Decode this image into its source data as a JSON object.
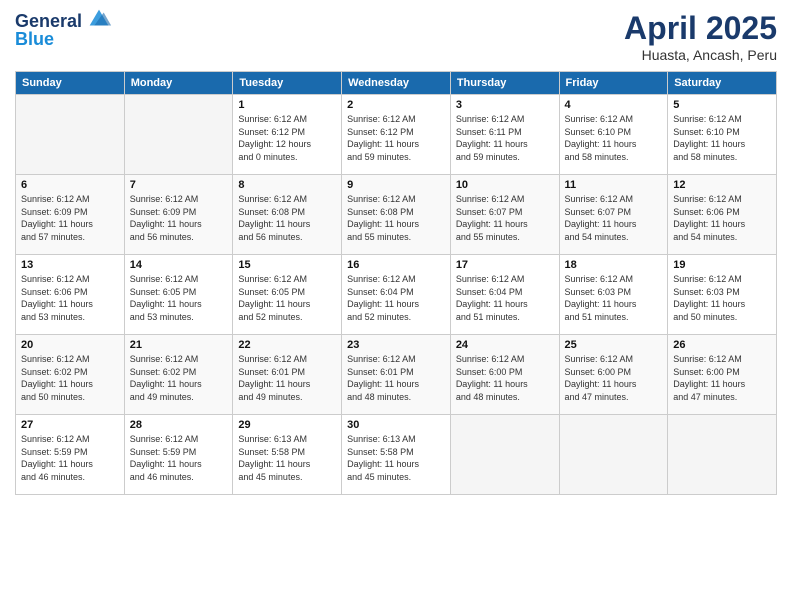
{
  "logo": {
    "line1": "General",
    "line2": "Blue"
  },
  "title": "April 2025",
  "subtitle": "Huasta, Ancash, Peru",
  "weekdays": [
    "Sunday",
    "Monday",
    "Tuesday",
    "Wednesday",
    "Thursday",
    "Friday",
    "Saturday"
  ],
  "weeks": [
    [
      {
        "day": "",
        "info": ""
      },
      {
        "day": "",
        "info": ""
      },
      {
        "day": "1",
        "info": "Sunrise: 6:12 AM\nSunset: 6:12 PM\nDaylight: 12 hours\nand 0 minutes."
      },
      {
        "day": "2",
        "info": "Sunrise: 6:12 AM\nSunset: 6:12 PM\nDaylight: 11 hours\nand 59 minutes."
      },
      {
        "day": "3",
        "info": "Sunrise: 6:12 AM\nSunset: 6:11 PM\nDaylight: 11 hours\nand 59 minutes."
      },
      {
        "day": "4",
        "info": "Sunrise: 6:12 AM\nSunset: 6:10 PM\nDaylight: 11 hours\nand 58 minutes."
      },
      {
        "day": "5",
        "info": "Sunrise: 6:12 AM\nSunset: 6:10 PM\nDaylight: 11 hours\nand 58 minutes."
      }
    ],
    [
      {
        "day": "6",
        "info": "Sunrise: 6:12 AM\nSunset: 6:09 PM\nDaylight: 11 hours\nand 57 minutes."
      },
      {
        "day": "7",
        "info": "Sunrise: 6:12 AM\nSunset: 6:09 PM\nDaylight: 11 hours\nand 56 minutes."
      },
      {
        "day": "8",
        "info": "Sunrise: 6:12 AM\nSunset: 6:08 PM\nDaylight: 11 hours\nand 56 minutes."
      },
      {
        "day": "9",
        "info": "Sunrise: 6:12 AM\nSunset: 6:08 PM\nDaylight: 11 hours\nand 55 minutes."
      },
      {
        "day": "10",
        "info": "Sunrise: 6:12 AM\nSunset: 6:07 PM\nDaylight: 11 hours\nand 55 minutes."
      },
      {
        "day": "11",
        "info": "Sunrise: 6:12 AM\nSunset: 6:07 PM\nDaylight: 11 hours\nand 54 minutes."
      },
      {
        "day": "12",
        "info": "Sunrise: 6:12 AM\nSunset: 6:06 PM\nDaylight: 11 hours\nand 54 minutes."
      }
    ],
    [
      {
        "day": "13",
        "info": "Sunrise: 6:12 AM\nSunset: 6:06 PM\nDaylight: 11 hours\nand 53 minutes."
      },
      {
        "day": "14",
        "info": "Sunrise: 6:12 AM\nSunset: 6:05 PM\nDaylight: 11 hours\nand 53 minutes."
      },
      {
        "day": "15",
        "info": "Sunrise: 6:12 AM\nSunset: 6:05 PM\nDaylight: 11 hours\nand 52 minutes."
      },
      {
        "day": "16",
        "info": "Sunrise: 6:12 AM\nSunset: 6:04 PM\nDaylight: 11 hours\nand 52 minutes."
      },
      {
        "day": "17",
        "info": "Sunrise: 6:12 AM\nSunset: 6:04 PM\nDaylight: 11 hours\nand 51 minutes."
      },
      {
        "day": "18",
        "info": "Sunrise: 6:12 AM\nSunset: 6:03 PM\nDaylight: 11 hours\nand 51 minutes."
      },
      {
        "day": "19",
        "info": "Sunrise: 6:12 AM\nSunset: 6:03 PM\nDaylight: 11 hours\nand 50 minutes."
      }
    ],
    [
      {
        "day": "20",
        "info": "Sunrise: 6:12 AM\nSunset: 6:02 PM\nDaylight: 11 hours\nand 50 minutes."
      },
      {
        "day": "21",
        "info": "Sunrise: 6:12 AM\nSunset: 6:02 PM\nDaylight: 11 hours\nand 49 minutes."
      },
      {
        "day": "22",
        "info": "Sunrise: 6:12 AM\nSunset: 6:01 PM\nDaylight: 11 hours\nand 49 minutes."
      },
      {
        "day": "23",
        "info": "Sunrise: 6:12 AM\nSunset: 6:01 PM\nDaylight: 11 hours\nand 48 minutes."
      },
      {
        "day": "24",
        "info": "Sunrise: 6:12 AM\nSunset: 6:00 PM\nDaylight: 11 hours\nand 48 minutes."
      },
      {
        "day": "25",
        "info": "Sunrise: 6:12 AM\nSunset: 6:00 PM\nDaylight: 11 hours\nand 47 minutes."
      },
      {
        "day": "26",
        "info": "Sunrise: 6:12 AM\nSunset: 6:00 PM\nDaylight: 11 hours\nand 47 minutes."
      }
    ],
    [
      {
        "day": "27",
        "info": "Sunrise: 6:12 AM\nSunset: 5:59 PM\nDaylight: 11 hours\nand 46 minutes."
      },
      {
        "day": "28",
        "info": "Sunrise: 6:12 AM\nSunset: 5:59 PM\nDaylight: 11 hours\nand 46 minutes."
      },
      {
        "day": "29",
        "info": "Sunrise: 6:13 AM\nSunset: 5:58 PM\nDaylight: 11 hours\nand 45 minutes."
      },
      {
        "day": "30",
        "info": "Sunrise: 6:13 AM\nSunset: 5:58 PM\nDaylight: 11 hours\nand 45 minutes."
      },
      {
        "day": "",
        "info": ""
      },
      {
        "day": "",
        "info": ""
      },
      {
        "day": "",
        "info": ""
      }
    ]
  ]
}
